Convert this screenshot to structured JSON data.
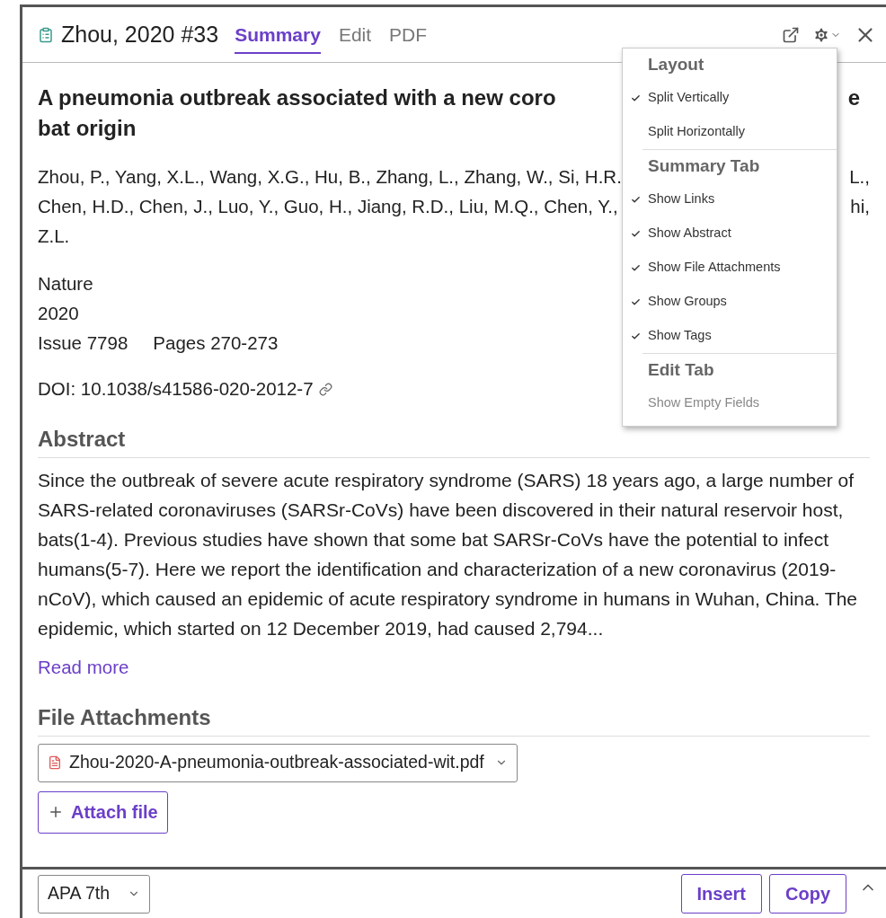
{
  "header": {
    "title": "Zhou, 2020 #33",
    "tabs": [
      {
        "label": "Summary",
        "selected": true
      },
      {
        "label": "Edit",
        "selected": false
      },
      {
        "label": "PDF",
        "selected": false
      }
    ]
  },
  "reference": {
    "title_lines": [
      {
        "left": "A pneumonia outbreak associated with a new coro",
        "right": "e"
      },
      {
        "left": "bat origin"
      }
    ],
    "author_lines": [
      {
        "left": "Zhou, P., Yang, X.L., Wang, X.G., Hu, B., Zhang, L., Zhang, W., Si, H.R.",
        "right": "L.,"
      },
      {
        "left": "Chen, H.D., Chen, J., Luo, Y., Guo, H., Jiang, R.D., Liu, M.Q., Chen, Y.,",
        "right": "hi,"
      },
      {
        "left": "Z.L."
      }
    ],
    "journal": "Nature",
    "year": "2020",
    "issue": "Issue 7798",
    "pages": "Pages 270-273",
    "doi": "DOI: 10.1038/s41586-020-2012-7"
  },
  "abstract": {
    "heading": "Abstract",
    "text": "Since the outbreak of severe acute respiratory syndrome (SARS) 18 years ago, a large number of SARS-related coronaviruses (SARSr-CoVs) have been discovered in their natural reservoir host, bats(1-4). Previous studies have shown that some bat SARSr-CoVs have the potential to infect humans(5-7). Here we report the identification and characterization of a new coronavirus (2019-nCoV), which caused an epidemic of acute respiratory syndrome in humans in Wuhan, China. The epidemic, which started on 12 December 2019, had caused 2,794...",
    "read_more": "Read more"
  },
  "attachments": {
    "heading": "File Attachments",
    "files": [
      "Zhou-2020-A-pneumonia-outbreak-associated-wit.pdf"
    ],
    "attach_button": "Attach file"
  },
  "menu": [
    {
      "kind": "header",
      "label": "Layout"
    },
    {
      "kind": "item",
      "label": "Split Vertically",
      "checked": true,
      "disabled": false
    },
    {
      "kind": "item",
      "label": "Split Horizontally",
      "checked": false,
      "disabled": false
    },
    {
      "kind": "header",
      "label": "Summary Tab"
    },
    {
      "kind": "item",
      "label": "Show Links",
      "checked": true,
      "disabled": false
    },
    {
      "kind": "item",
      "label": "Show Abstract",
      "checked": true,
      "disabled": false
    },
    {
      "kind": "item",
      "label": "Show File Attachments",
      "checked": true,
      "disabled": false
    },
    {
      "kind": "item",
      "label": "Show Groups",
      "checked": true,
      "disabled": false
    },
    {
      "kind": "item",
      "label": "Show Tags",
      "checked": true,
      "disabled": false
    },
    {
      "kind": "header",
      "label": "Edit Tab"
    },
    {
      "kind": "item",
      "label": "Show Empty Fields",
      "checked": false,
      "disabled": true
    }
  ],
  "footer": {
    "style": "APA 7th",
    "buttons": [
      "Insert",
      "Copy"
    ]
  }
}
